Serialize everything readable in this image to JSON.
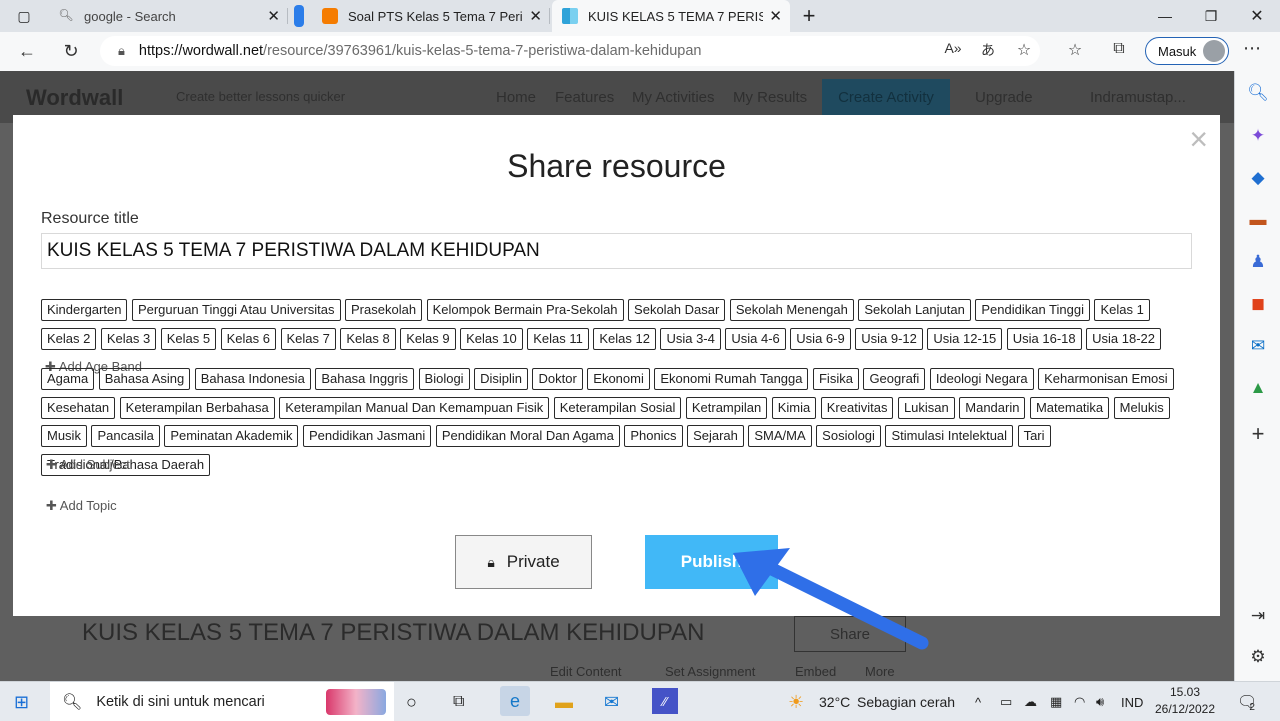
{
  "browser": {
    "tabs": [
      {
        "title": "google - Search",
        "close": "✕"
      },
      {
        "title": "Soal PTS Kelas 5 Tema 7 Peristiwa",
        "close": "✕"
      },
      {
        "title": "KUIS KELAS 5 TEMA 7 PERISTIWA",
        "close": "✕"
      }
    ],
    "new_tab": "+",
    "url_host": "https://wordwall.net",
    "url_path": "/resource/39763961/kuis-kelas-5-tema-7-peristiwa-dalam-kehidupan",
    "profile_label": "Masuk"
  },
  "site": {
    "logo": "Wordwall",
    "tagline": "Create better lessons quicker",
    "nav": [
      "Home",
      "Features",
      "My Activities",
      "My Results"
    ],
    "create_label": "Create Activity",
    "upgrade_label": "Upgrade",
    "user_label": "Indramustap...",
    "behind_title": "KUIS KELAS 5 TEMA 7 PERISTIWA DALAM KEHIDUPAN",
    "share_label": "Share",
    "bottom_links": [
      "Edit Content",
      "Set Assignment",
      "Embed",
      "More"
    ]
  },
  "modal": {
    "heading": "Share resource",
    "title_label": "Resource title",
    "title_value": "KUIS KELAS 5 TEMA 7 PERISTIWA DALAM KEHIDUPAN",
    "age_tags": [
      "Kindergarten",
      "Perguruan Tinggi Atau Universitas",
      "Prasekolah",
      "Kelompok Bermain Pra-Sekolah",
      "Sekolah Dasar",
      "Sekolah Menengah",
      "Sekolah Lanjutan",
      "Pendidikan Tinggi",
      "Kelas 1",
      "Kelas 2",
      "Kelas 3",
      "Kelas 5",
      "Kelas 6",
      "Kelas 7",
      "Kelas 8",
      "Kelas 9",
      "Kelas 10",
      "Kelas 11",
      "Kelas 12",
      "Usia 3-4",
      "Usia 4-6",
      "Usia 6-9",
      "Usia 9-12",
      "Usia 12-15",
      "Usia 16-18",
      "Usia 18-22"
    ],
    "add_age_label": "Add Age Band",
    "subject_tags": [
      "Agama",
      "Bahasa Asing",
      "Bahasa Indonesia",
      "Bahasa Inggris",
      "Biologi",
      "Disiplin",
      "Doktor",
      "Ekonomi",
      "Ekonomi Rumah Tangga",
      "Fisika",
      "Geografi",
      "Ideologi Negara",
      "Keharmonisan Emosi",
      "Kesehatan",
      "Keterampilan Berbahasa",
      "Keterampilan Manual Dan Kemampuan Fisik",
      "Keterampilan Sosial",
      "Ketrampilan",
      "Kimia",
      "Kreativitas",
      "Lukisan",
      "Mandarin",
      "Matematika",
      "Melukis",
      "Musik",
      "Pancasila",
      "Peminatan Akademik",
      "Pendidikan Jasmani",
      "Pendidikan Moral Dan Agama",
      "Phonics",
      "Sejarah",
      "SMA/MA",
      "Sosiologi",
      "Stimulasi Intelektual",
      "Tari",
      "Tradisional/Bahasa Daerah"
    ],
    "add_subject_label": "Add Subject",
    "add_topic_label": "Add Topic",
    "private_label": "Private",
    "publish_label": "Publish",
    "close_label": "×"
  },
  "taskbar": {
    "search_placeholder": "Ketik di sini untuk mencari",
    "weather_temp": "32°C",
    "weather_desc": "Sebagian cerah",
    "language": "IND",
    "time": "15.03",
    "date": "26/12/2022",
    "notif_count": "2"
  },
  "colors": {
    "publish": "#41b8f7",
    "arrow": "#2f6fe8"
  }
}
